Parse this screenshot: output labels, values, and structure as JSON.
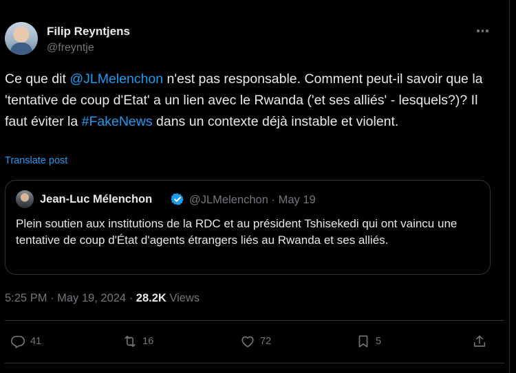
{
  "author": {
    "display_name": "Filip Reyntjens",
    "handle": "@freyntje"
  },
  "post": {
    "text_1": "Ce que dit ",
    "mention": "@JLMelenchon",
    "text_2": " n'est pas responsable. Comment peut-il savoir que la 'tentative de coup d'Etat' a un lien avec le Rwanda ('et ses alliés' - lesquels?)? Il faut éviter la ",
    "hashtag": "#FakeNews",
    "text_3": " dans un contexte déjà instable et violent.",
    "translate_label": "Translate post"
  },
  "quote": {
    "display_name": "Jean-Luc Mélenchon",
    "handle": "@JLMelenchon",
    "separator": " · ",
    "date": "May 19",
    "text": "Plein soutien aux institutions de la RDC et au président Tshisekedi qui ont vaincu une tentative de coup d'État d'agents étrangers liés au Rwanda et ses alliés."
  },
  "meta": {
    "time": "5:25 PM",
    "separator": " · ",
    "date": "May 19, 2024",
    "views_count": "28.2K",
    "views_label": " Views"
  },
  "actions": {
    "replies": "41",
    "reposts": "16",
    "likes": "72",
    "bookmarks": "5"
  },
  "icons": {
    "more": "more-horizontal-icon",
    "verified": "verified-badge-icon",
    "reply": "reply-icon",
    "repost": "repost-icon",
    "like": "heart-icon",
    "bookmark": "bookmark-icon",
    "share": "share-icon"
  },
  "colors": {
    "background": "#000000",
    "text": "#e7e9ea",
    "muted": "#71767b",
    "link": "#1d9bf0",
    "border": "#2f3336"
  }
}
